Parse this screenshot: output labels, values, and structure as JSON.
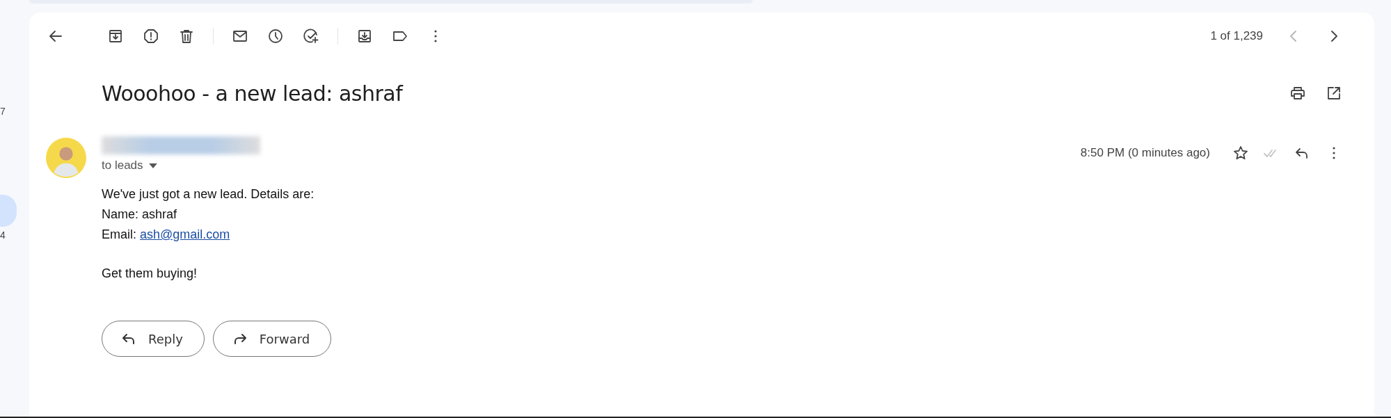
{
  "sidebar": {
    "items": [
      {
        "count": "7",
        "selected": false
      },
      {
        "selected": true
      },
      {
        "count": "4",
        "selected": false
      }
    ]
  },
  "toolbar": {
    "position": "1 of 1,239",
    "prev_disabled": true,
    "next_disabled": false
  },
  "message": {
    "subject": "Wooohoo - a new lead: ashraf",
    "recipient": "to leads",
    "time": "8:50 PM (0 minutes ago)",
    "starred": false,
    "body": [
      "We've just got a new lead. Details are:",
      "Name: ashraf"
    ],
    "email_label": "Email: ",
    "email_link": "ash@gmail.com",
    "closing": "Get them buying!"
  },
  "actions": [
    {
      "kind": "reply",
      "label": "Reply"
    },
    {
      "kind": "forward",
      "label": "Forward"
    }
  ]
}
